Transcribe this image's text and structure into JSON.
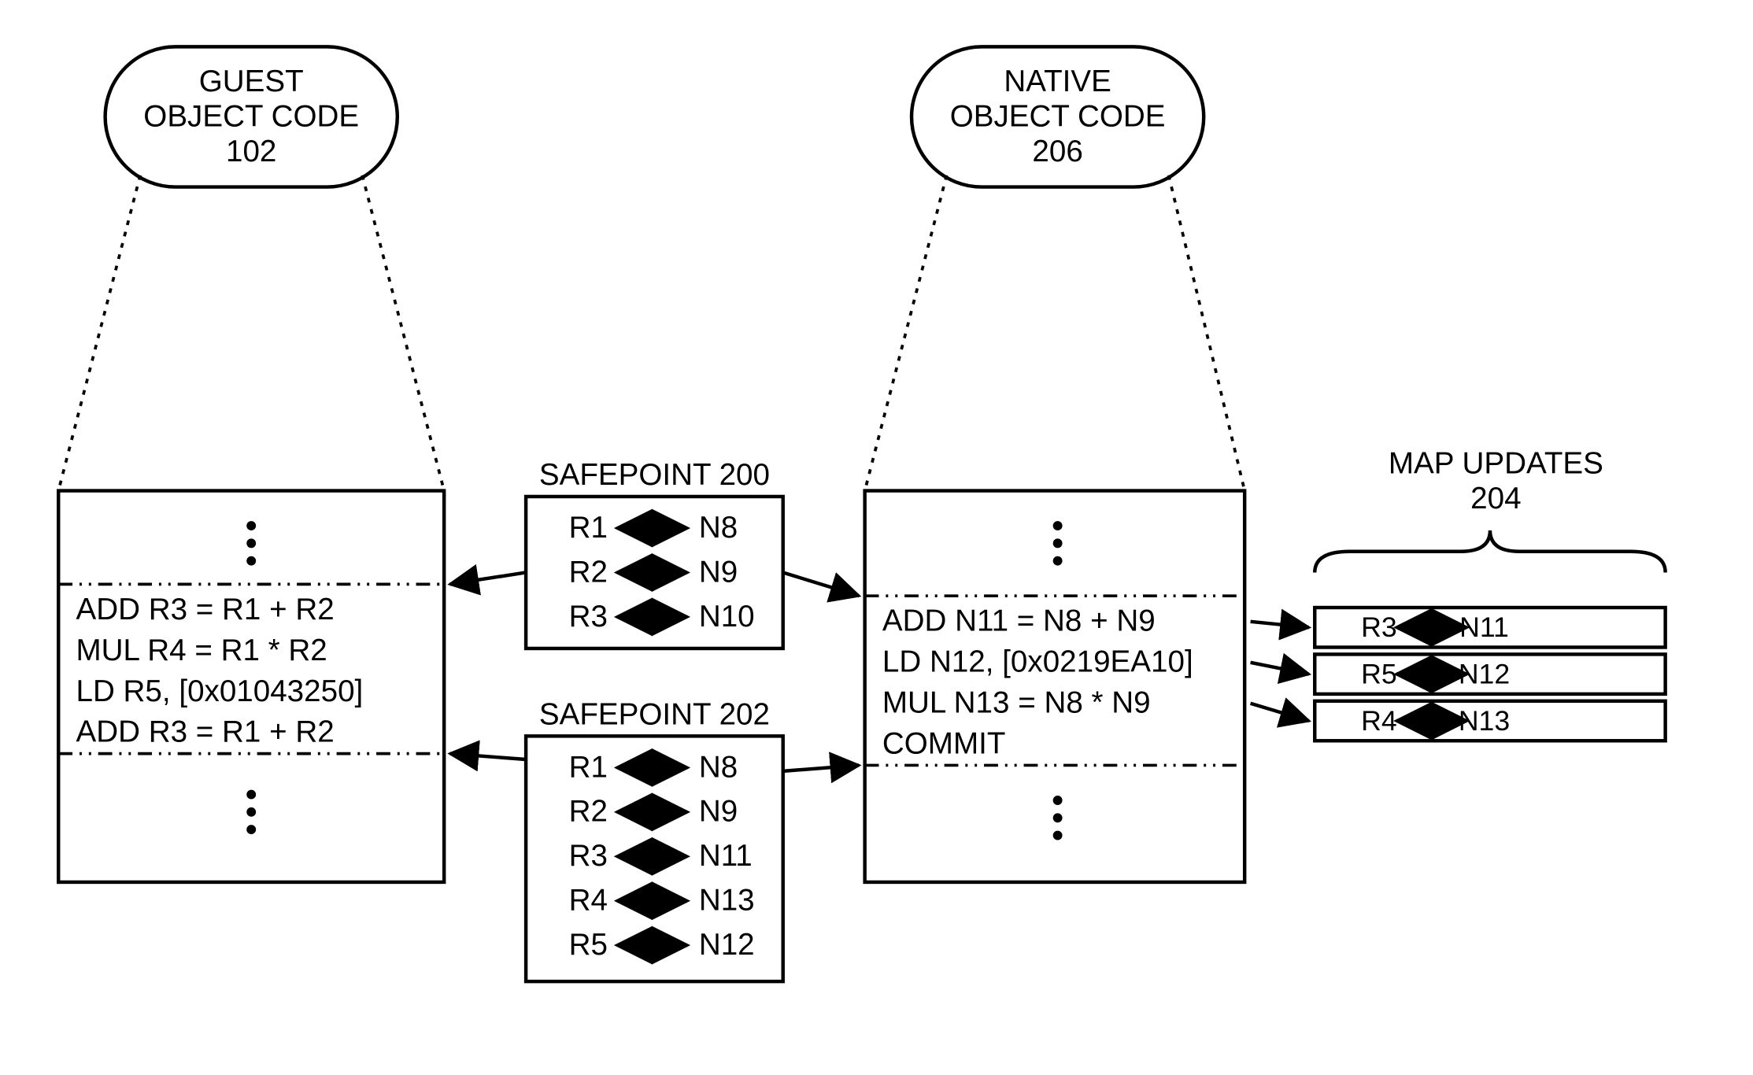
{
  "guest": {
    "title_l1": "GUEST",
    "title_l2": "OBJECT CODE",
    "title_l3": "102",
    "code": [
      "ADD R3 = R1 + R2",
      "MUL R4 = R1 * R2",
      "LD    R5, [0x01043250]",
      "ADD R3 = R1 + R2"
    ]
  },
  "native": {
    "title_l1": "NATIVE",
    "title_l2": "OBJECT CODE",
    "title_l3": "206",
    "code": [
      "ADD N11 = N8 + N9",
      "LD    N12, [0x0219EA10]",
      "MUL N13 = N8 * N9",
      "COMMIT"
    ]
  },
  "safepoint200": {
    "title": "SAFEPOINT 200",
    "rows": [
      {
        "l": "R1",
        "r": "N8"
      },
      {
        "l": "R2",
        "r": "N9"
      },
      {
        "l": "R3",
        "r": "N10"
      }
    ]
  },
  "safepoint202": {
    "title": "SAFEPOINT 202",
    "rows": [
      {
        "l": "R1",
        "r": "N8"
      },
      {
        "l": "R2",
        "r": "N9"
      },
      {
        "l": "R3",
        "r": "N11"
      },
      {
        "l": "R4",
        "r": "N13"
      },
      {
        "l": "R5",
        "r": "N12"
      }
    ]
  },
  "mapupdates": {
    "title_l1": "MAP UPDATES",
    "title_l2": "204",
    "rows": [
      {
        "l": "R3",
        "r": "N11"
      },
      {
        "l": "R5",
        "r": "N12"
      },
      {
        "l": "R4",
        "r": "N13"
      }
    ]
  }
}
